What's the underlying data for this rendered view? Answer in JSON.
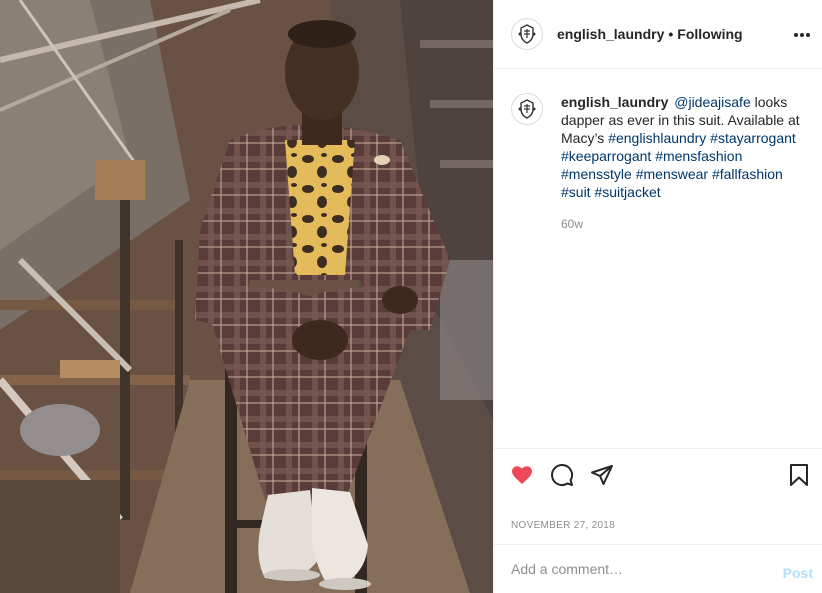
{
  "post": {
    "author": "english_laundry",
    "separator": "•",
    "follow_status": "Following",
    "avatar_icon": "crest-logo-icon",
    "caption": {
      "username": "english_laundry",
      "parts": [
        {
          "type": "mention",
          "text": "@jideajisafe"
        },
        {
          "type": "text",
          "text": " looks dapper as ever in this suit. Available at Macy’s "
        },
        {
          "type": "tag",
          "text": "#englishlaundry"
        },
        {
          "type": "text",
          "text": " "
        },
        {
          "type": "tag",
          "text": "#stayarrogant"
        },
        {
          "type": "text",
          "text": " "
        },
        {
          "type": "tag",
          "text": "#keeparrogant"
        },
        {
          "type": "text",
          "text": " "
        },
        {
          "type": "tag",
          "text": "#mensfashion"
        },
        {
          "type": "text",
          "text": " "
        },
        {
          "type": "tag",
          "text": "#mensstyle"
        },
        {
          "type": "text",
          "text": " "
        },
        {
          "type": "tag",
          "text": "#menswear"
        },
        {
          "type": "text",
          "text": " "
        },
        {
          "type": "tag",
          "text": "#fallfashion"
        },
        {
          "type": "text",
          "text": " "
        },
        {
          "type": "tag",
          "text": "#suit"
        },
        {
          "type": "text",
          "text": " "
        },
        {
          "type": "tag",
          "text": "#suitjacket"
        }
      ],
      "time_ago": "60w"
    },
    "date": "NOVEMBER 27, 2018",
    "liked": true
  },
  "actions": {
    "like_icon": "heart-filled-icon",
    "comment_icon": "comment-bubble-icon",
    "share_icon": "paper-plane-icon",
    "save_icon": "bookmark-icon",
    "more_icon": "more-horizontal-icon"
  },
  "comment_box": {
    "placeholder": "Add a comment…",
    "value": "",
    "post_label": "Post"
  },
  "colors": {
    "like": "#ed4956",
    "link": "#00376b",
    "post_button": "#b2dffc",
    "muted": "#8e8e8e",
    "divider": "#efefef"
  }
}
